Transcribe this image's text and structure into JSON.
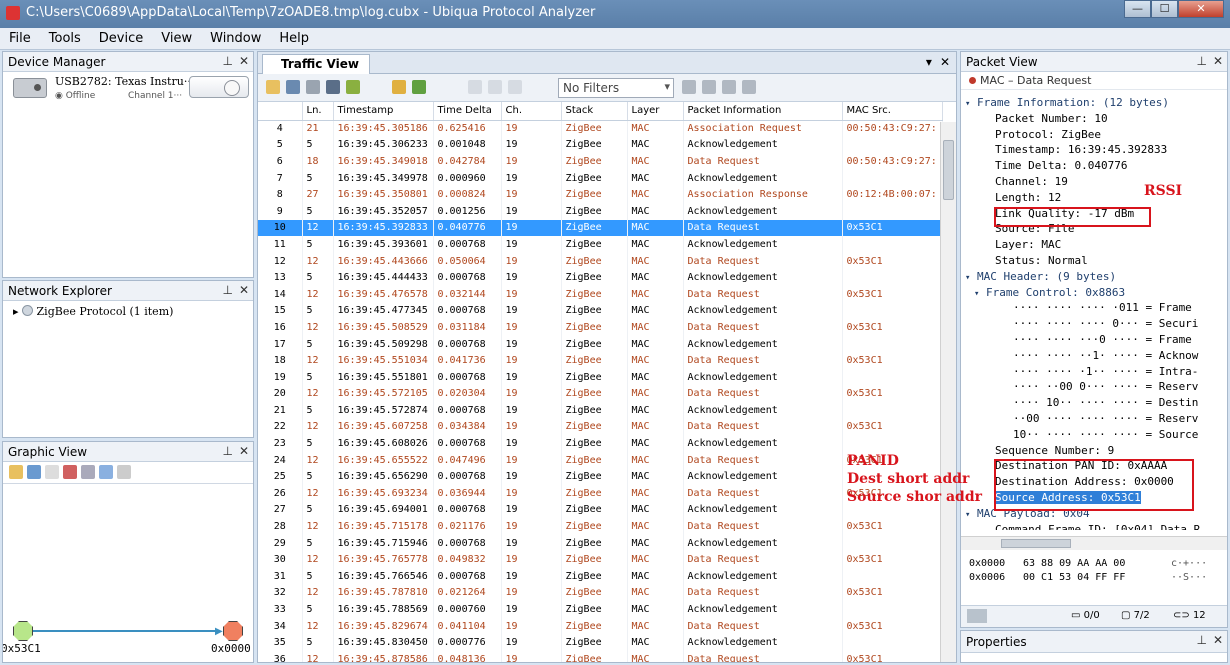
{
  "window": {
    "title": "C:\\Users\\C0689\\AppData\\Local\\Temp\\7zOADE8.tmp\\log.cubx - Ubiqua Protocol Analyzer",
    "min": "—",
    "max": "☐",
    "close": "✕"
  },
  "menu": [
    "File",
    "Tools",
    "Device",
    "View",
    "Window",
    "Help"
  ],
  "device_manager": {
    "title": "Device Manager",
    "name": "USB2782: Texas Instru···",
    "status": "Offline",
    "channel": "Channel 1···"
  },
  "network_explorer": {
    "title": "Network Explorer",
    "item": "ZigBee Protocol (1 item)"
  },
  "graphic_view": {
    "title": "Graphic View",
    "node_left": "0x53C1",
    "node_right": "0x0000"
  },
  "traffic_view": {
    "tab": "Traffic View",
    "filter": "No Filters",
    "columns": [
      "Ln.",
      "Timestamp",
      "Time Delta",
      "Ch.",
      "Stack",
      "Layer",
      "Packet Information",
      "MAC Src."
    ],
    "rows": [
      [
        "4",
        "21",
        "16:39:45.305186",
        "0.625416",
        "19",
        "ZigBee",
        "MAC",
        "Association Request",
        "00:50:43:C9:27:"
      ],
      [
        "5",
        "5",
        "16:39:45.306233",
        "0.001048",
        "19",
        "ZigBee",
        "MAC",
        "Acknowledgement",
        ""
      ],
      [
        "6",
        "18",
        "16:39:45.349018",
        "0.042784",
        "19",
        "ZigBee",
        "MAC",
        "Data Request",
        "00:50:43:C9:27:"
      ],
      [
        "7",
        "5",
        "16:39:45.349978",
        "0.000960",
        "19",
        "ZigBee",
        "MAC",
        "Acknowledgement",
        ""
      ],
      [
        "8",
        "27",
        "16:39:45.350801",
        "0.000824",
        "19",
        "ZigBee",
        "MAC",
        "Association Response",
        "00:12:4B:00:07:"
      ],
      [
        "9",
        "5",
        "16:39:45.352057",
        "0.001256",
        "19",
        "ZigBee",
        "MAC",
        "Acknowledgement",
        ""
      ],
      [
        "10",
        "12",
        "16:39:45.392833",
        "0.040776",
        "19",
        "ZigBee",
        "MAC",
        "Data Request",
        "0x53C1"
      ],
      [
        "11",
        "5",
        "16:39:45.393601",
        "0.000768",
        "19",
        "ZigBee",
        "MAC",
        "Acknowledgement",
        ""
      ],
      [
        "12",
        "12",
        "16:39:45.443666",
        "0.050064",
        "19",
        "ZigBee",
        "MAC",
        "Data Request",
        "0x53C1"
      ],
      [
        "13",
        "5",
        "16:39:45.444433",
        "0.000768",
        "19",
        "ZigBee",
        "MAC",
        "Acknowledgement",
        ""
      ],
      [
        "14",
        "12",
        "16:39:45.476578",
        "0.032144",
        "19",
        "ZigBee",
        "MAC",
        "Data Request",
        "0x53C1"
      ],
      [
        "15",
        "5",
        "16:39:45.477345",
        "0.000768",
        "19",
        "ZigBee",
        "MAC",
        "Acknowledgement",
        ""
      ],
      [
        "16",
        "12",
        "16:39:45.508529",
        "0.031184",
        "19",
        "ZigBee",
        "MAC",
        "Data Request",
        "0x53C1"
      ],
      [
        "17",
        "5",
        "16:39:45.509298",
        "0.000768",
        "19",
        "ZigBee",
        "MAC",
        "Acknowledgement",
        ""
      ],
      [
        "18",
        "12",
        "16:39:45.551034",
        "0.041736",
        "19",
        "ZigBee",
        "MAC",
        "Data Request",
        "0x53C1"
      ],
      [
        "19",
        "5",
        "16:39:45.551801",
        "0.000768",
        "19",
        "ZigBee",
        "MAC",
        "Acknowledgement",
        ""
      ],
      [
        "20",
        "12",
        "16:39:45.572105",
        "0.020304",
        "19",
        "ZigBee",
        "MAC",
        "Data Request",
        "0x53C1"
      ],
      [
        "21",
        "5",
        "16:39:45.572874",
        "0.000768",
        "19",
        "ZigBee",
        "MAC",
        "Acknowledgement",
        ""
      ],
      [
        "22",
        "12",
        "16:39:45.607258",
        "0.034384",
        "19",
        "ZigBee",
        "MAC",
        "Data Request",
        "0x53C1"
      ],
      [
        "23",
        "5",
        "16:39:45.608026",
        "0.000768",
        "19",
        "ZigBee",
        "MAC",
        "Acknowledgement",
        ""
      ],
      [
        "24",
        "12",
        "16:39:45.655522",
        "0.047496",
        "19",
        "ZigBee",
        "MAC",
        "Data Request",
        "0x53C1"
      ],
      [
        "25",
        "5",
        "16:39:45.656290",
        "0.000768",
        "19",
        "ZigBee",
        "MAC",
        "Acknowledgement",
        ""
      ],
      [
        "26",
        "12",
        "16:39:45.693234",
        "0.036944",
        "19",
        "ZigBee",
        "MAC",
        "Data Request",
        "0x53C1"
      ],
      [
        "27",
        "5",
        "16:39:45.694001",
        "0.000768",
        "19",
        "ZigBee",
        "MAC",
        "Acknowledgement",
        ""
      ],
      [
        "28",
        "12",
        "16:39:45.715178",
        "0.021176",
        "19",
        "ZigBee",
        "MAC",
        "Data Request",
        "0x53C1"
      ],
      [
        "29",
        "5",
        "16:39:45.715946",
        "0.000768",
        "19",
        "ZigBee",
        "MAC",
        "Acknowledgement",
        ""
      ],
      [
        "30",
        "12",
        "16:39:45.765778",
        "0.049832",
        "19",
        "ZigBee",
        "MAC",
        "Data Request",
        "0x53C1"
      ],
      [
        "31",
        "5",
        "16:39:45.766546",
        "0.000768",
        "19",
        "ZigBee",
        "MAC",
        "Acknowledgement",
        ""
      ],
      [
        "32",
        "12",
        "16:39:45.787810",
        "0.021264",
        "19",
        "ZigBee",
        "MAC",
        "Data Request",
        "0x53C1"
      ],
      [
        "33",
        "5",
        "16:39:45.788569",
        "0.000760",
        "19",
        "ZigBee",
        "MAC",
        "Acknowledgement",
        ""
      ],
      [
        "34",
        "12",
        "16:39:45.829674",
        "0.041104",
        "19",
        "ZigBee",
        "MAC",
        "Data Request",
        "0x53C1"
      ],
      [
        "35",
        "5",
        "16:39:45.830450",
        "0.000776",
        "19",
        "ZigBee",
        "MAC",
        "Acknowledgement",
        ""
      ],
      [
        "36",
        "12",
        "16:39:45.878586",
        "0.048136",
        "19",
        "ZigBee",
        "MAC",
        "Data Request",
        "0x53C1"
      ]
    ],
    "selected_row": 6
  },
  "packet_view": {
    "title": "Packet View",
    "subtitle": "MAC – Data Request",
    "lines": [
      {
        "ind": 0,
        "exp": "▾",
        "text": "Frame Information: (12 bytes)"
      },
      {
        "ind": 2,
        "exp": "",
        "text": "Packet Number: 10"
      },
      {
        "ind": 2,
        "exp": "",
        "text": "Protocol: ZigBee"
      },
      {
        "ind": 2,
        "exp": "",
        "text": "Timestamp: 16:39:45.392833"
      },
      {
        "ind": 2,
        "exp": "",
        "text": "Time Delta: 0.040776"
      },
      {
        "ind": 2,
        "exp": "",
        "text": "Channel: 19"
      },
      {
        "ind": 2,
        "exp": "",
        "text": "Length: 12"
      },
      {
        "ind": 2,
        "exp": "",
        "text": "Link Quality: -17 dBm"
      },
      {
        "ind": 2,
        "exp": "",
        "text": "Source: File"
      },
      {
        "ind": 2,
        "exp": "",
        "text": "Layer: MAC"
      },
      {
        "ind": 2,
        "exp": "",
        "text": "Status: Normal"
      },
      {
        "ind": 0,
        "exp": "▾",
        "text": "MAC Header: (9 bytes)"
      },
      {
        "ind": 1,
        "exp": "▾",
        "text": "Frame Control: 0x8863"
      },
      {
        "ind": 4,
        "exp": "",
        "text": "···· ···· ···· ·011 = Frame"
      },
      {
        "ind": 4,
        "exp": "",
        "text": "···· ···· ···· 0··· = Securi"
      },
      {
        "ind": 4,
        "exp": "",
        "text": "···· ···· ···0 ···· = Frame"
      },
      {
        "ind": 4,
        "exp": "",
        "text": "···· ···· ··1· ···· = Acknow"
      },
      {
        "ind": 4,
        "exp": "",
        "text": "···· ···· ·1·· ···· = Intra-"
      },
      {
        "ind": 4,
        "exp": "",
        "text": "···· ··00 0··· ···· = Reserv"
      },
      {
        "ind": 4,
        "exp": "",
        "text": "···· 10·· ···· ···· = Destin"
      },
      {
        "ind": 4,
        "exp": "",
        "text": "··00 ···· ···· ···· = Reserv"
      },
      {
        "ind": 4,
        "exp": "",
        "text": "10·· ···· ···· ···· = Source"
      },
      {
        "ind": 2,
        "exp": "",
        "text": "Sequence Number: 9"
      },
      {
        "ind": 2,
        "exp": "",
        "text": "Destination PAN ID: 0xAAAA"
      },
      {
        "ind": 2,
        "exp": "",
        "text": "Destination Address: 0x0000"
      },
      {
        "ind": 2,
        "exp": "",
        "text": "Source Address: 0x53C1"
      },
      {
        "ind": 0,
        "exp": "▾",
        "text": "MAC Payload: 0x04"
      },
      {
        "ind": 2,
        "exp": "",
        "text": "Command Frame ID: [0x04] Data R"
      }
    ],
    "highlight_line": 25,
    "hex": [
      {
        "off": "0x0000",
        "bytes": "63 88 09 AA AA 00",
        "ascii": "c·+···"
      },
      {
        "off": "0x0006",
        "bytes": "00 C1 53 04 FF FF",
        "ascii": "··S···"
      }
    ],
    "status": {
      "frames": "0/0",
      "pages": "7/2",
      "bytes": "12"
    }
  },
  "properties": {
    "title": "Properties"
  },
  "annotations": {
    "rssi": "RSSI",
    "panid": "PANID",
    "dest": "Dest short addr",
    "src": "Source shor addr"
  },
  "colors": {
    "selection": "#3399ff",
    "odd_row_text": "#b0471e",
    "annotation": "#d8141c"
  }
}
